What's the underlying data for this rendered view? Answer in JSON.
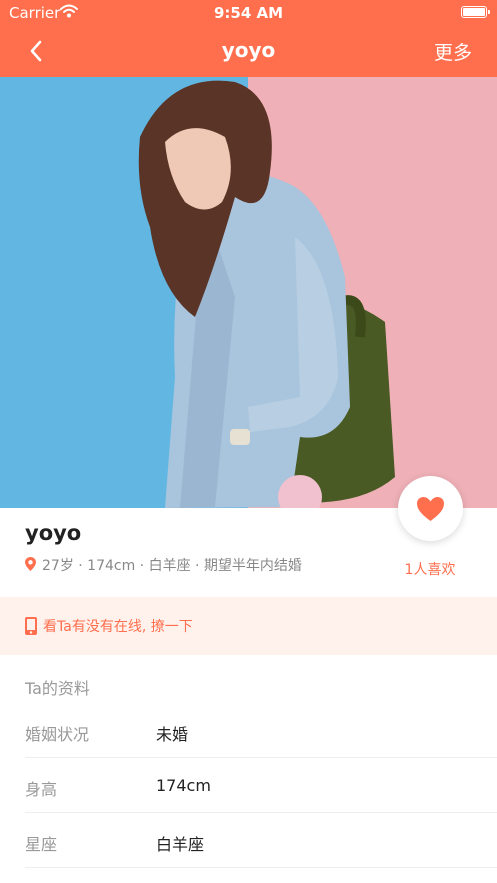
{
  "status_bar": {
    "carrier": "Carrier",
    "time": "9:54 AM"
  },
  "nav": {
    "title": "yoyo",
    "more_label": "更多"
  },
  "colors": {
    "accent": "#ff6f4e",
    "banner_bg": "#fff1ec"
  },
  "hero": {
    "image": "woman-denim-jacket-photo"
  },
  "user": {
    "name": "yoyo",
    "meta": "27岁 · 174cm · 白羊座 · 期望半年内结婚"
  },
  "like": {
    "count_label": "1人喜欢"
  },
  "online_banner": {
    "text": "看Ta有没有在线, 撩一下"
  },
  "profile": {
    "section_title": "Ta的资料",
    "rows": [
      {
        "label": "婚姻状况",
        "value": "未婚"
      },
      {
        "label": "身高",
        "value": "174cm"
      },
      {
        "label": "星座",
        "value": "白羊座"
      }
    ]
  }
}
